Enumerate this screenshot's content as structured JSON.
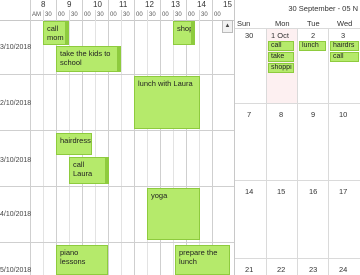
{
  "timeline": {
    "hours": [
      "8",
      "9",
      "10",
      "11",
      "12",
      "13",
      "14",
      "15"
    ],
    "slots": [
      "AM",
      "30",
      "00",
      "30",
      "00",
      "30",
      "00",
      "30",
      "00",
      "30",
      "00",
      "30",
      "00",
      "30",
      "00"
    ],
    "rows": [
      "3/10/2018",
      "2/10/2018",
      "3/10/2018",
      "4/10/2018",
      "5/10/2018"
    ],
    "events": {
      "call_mom": "call mom",
      "kids": "take the kids to school",
      "shop": "shop",
      "lunch_laura": "lunch with Laura",
      "hairdress": "hairdress",
      "call_laura": "call Laura",
      "yoga": "yoga",
      "piano": "piano lessons",
      "prepare_lunch": "prepare the lunch"
    },
    "scroll_up": "▲"
  },
  "month": {
    "range": "30 September - 05 N",
    "weekdays": [
      "Sun",
      "Mon",
      "Tue",
      "Wed"
    ],
    "weeks": [
      [
        "30",
        "1 Oct",
        "2",
        "3"
      ],
      [
        "7",
        "8",
        "9",
        "10"
      ],
      [
        "14",
        "15",
        "16",
        "17"
      ],
      [
        "21",
        "22",
        "23",
        "24"
      ]
    ],
    "events": {
      "mon_1": "call",
      "mon_2": "take",
      "mon_3": "shoppi",
      "tue_1": "lunch",
      "wed_1": "hairdrs",
      "wed_2": "call"
    }
  },
  "colors": {
    "event_fill": "#b5ea6b",
    "event_border": "#8ecb3e",
    "today_highlight": "#fdf0f1"
  }
}
